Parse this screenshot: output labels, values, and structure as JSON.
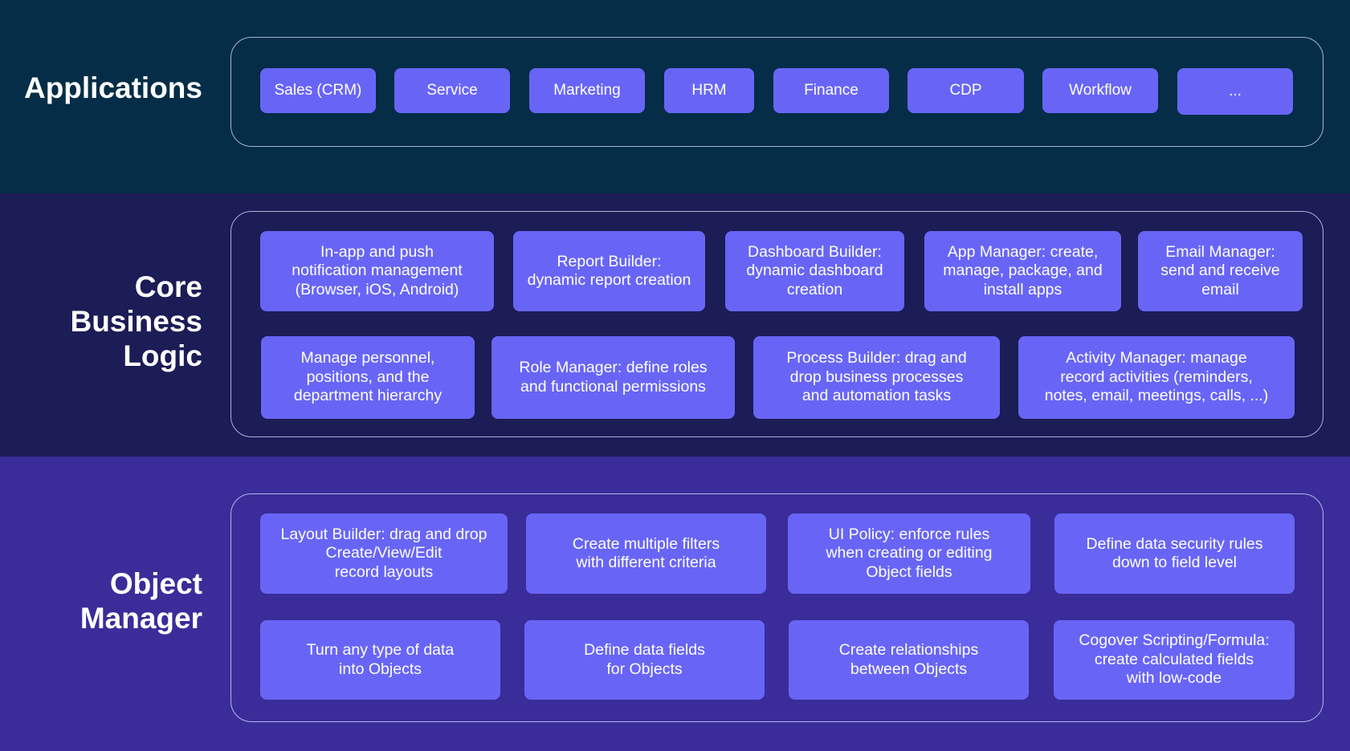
{
  "layers": {
    "applications": {
      "title": "Applications",
      "items": [
        "Sales (CRM)",
        "Service",
        "Marketing",
        "HRM",
        "Finance",
        "CDP",
        "Workflow",
        "..."
      ]
    },
    "core_business_logic": {
      "title": "Core\nBusiness\nLogic",
      "row1": [
        "In-app and push\nnotification management\n(Browser, iOS, Android)",
        "Report Builder:\ndynamic report creation",
        "Dashboard Builder:\ndynamic dashboard\ncreation",
        "App Manager: create,\nmanage, package, and\ninstall apps",
        "Email Manager:\nsend and receive email"
      ],
      "row2": [
        "Manage personnel,\npositions, and the\ndepartment hierarchy",
        "Role Manager: define roles\nand functional permissions",
        "Process Builder: drag and\ndrop business processes\nand automation tasks",
        "Activity Manager: manage\nrecord activities (reminders,\nnotes, email, meetings, calls, ...)"
      ]
    },
    "object_manager": {
      "title": "Object\nManager",
      "row1": [
        "Layout Builder: drag and drop\nCreate/View/Edit\nrecord layouts",
        "Create multiple filters\nwith different criteria",
        "UI Policy: enforce rules\nwhen creating or editing\nObject fields",
        "Define data security rules\ndown to field level"
      ],
      "row2": [
        "Turn any type of data\ninto Objects",
        "Define data fields\nfor Objects",
        "Create relationships\nbetween Objects",
        "Cogover Scripting/Formula:\ncreate calculated fields\nwith low-code"
      ]
    }
  },
  "colors": {
    "applications_band": "#052d47",
    "core_band": "#1c1c56",
    "object_band": "#3a2d9a",
    "chip": "#6865f6",
    "text": "#ffffff"
  }
}
